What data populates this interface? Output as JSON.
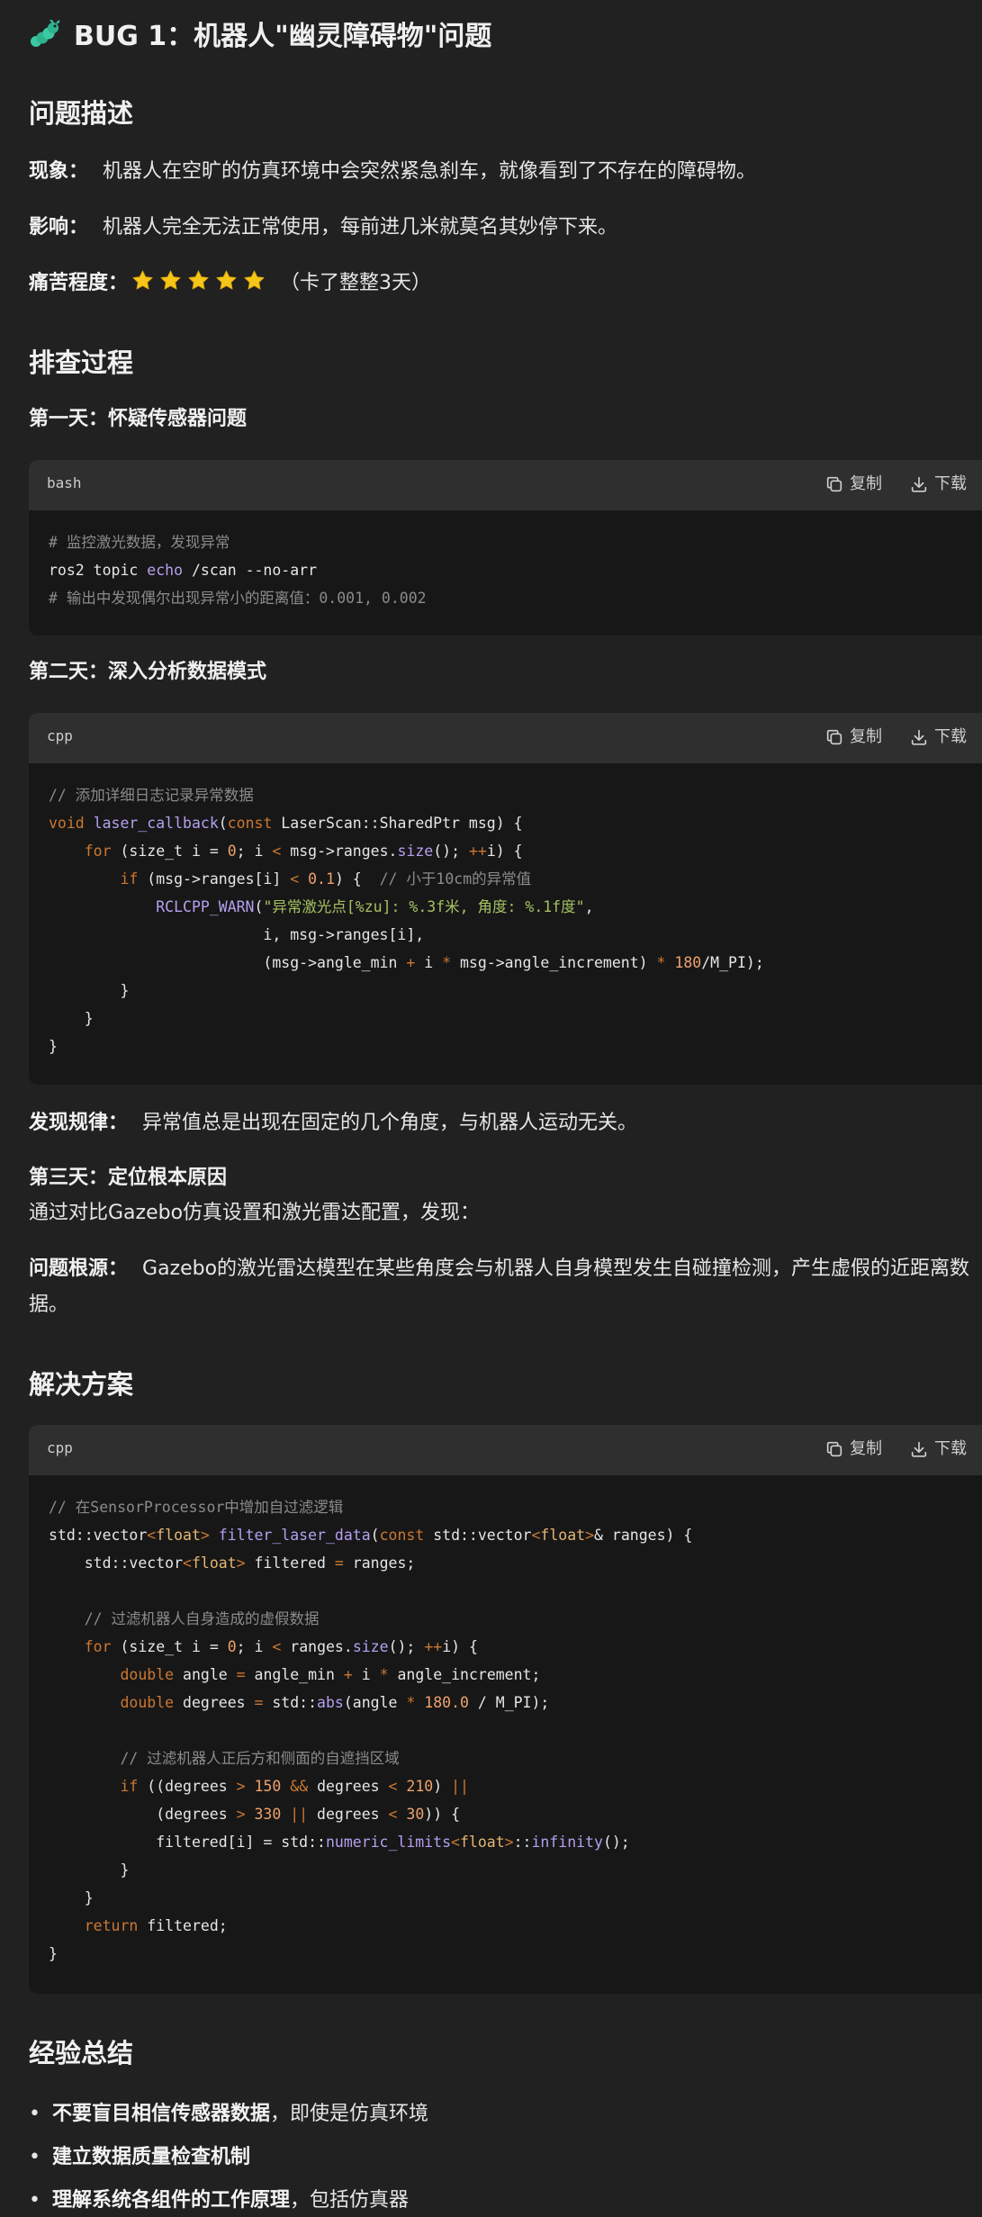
{
  "bug": {
    "icon": "caterpillar-bug-icon",
    "title": "BUG 1：机器人\"幽灵障碍物\"问题"
  },
  "problem": {
    "heading": "问题描述",
    "phenomenon_label": "现象：",
    "phenomenon_text": "机器人在空旷的仿真环境中会突然紧急刹车，就像看到了不存在的障碍物。",
    "impact_label": "影响：",
    "impact_text": "机器人完全无法正常使用，每前进几米就莫名其妙停下来。",
    "pain_label": "痛苦程度：",
    "pain_stars": 5,
    "pain_note": "（卡了整整3天）"
  },
  "investigation": {
    "heading": "排查过程",
    "day1": "第一天：怀疑传感器问题",
    "day2": "第二天：深入分析数据模式",
    "finding_label": "发现规律：",
    "finding_text": "异常值总是出现在固定的几个角度，与机器人运动无关。",
    "day3": "第三天：定位根本原因",
    "day3_text": "通过对比Gazebo仿真设置和激光雷达配置，发现：",
    "root_label": "问题根源：",
    "root_text_line1": "Gazebo的激光雷达模型在某些角度会与机器人自身模型发生自碰撞检测，产生虚假的近距离数",
    "root_text_line2": "据。"
  },
  "solution": {
    "heading": "解决方案"
  },
  "code_ui": {
    "copy_label": "复制",
    "download_label": "下载",
    "copy_icon": "copy-icon",
    "download_icon": "download-icon"
  },
  "code_blocks": [
    {
      "lang": "bash",
      "lines": [
        [
          [
            "c",
            "# 监控激光数据，发现异常"
          ]
        ],
        [
          [
            "p",
            "ros2 topic "
          ],
          [
            "f",
            "echo"
          ],
          [
            "p",
            " /scan --no-arr"
          ]
        ],
        [
          [
            "c",
            "# 输出中发现偶尔出现异常小的距离值：0.001, 0.002"
          ]
        ]
      ]
    },
    {
      "lang": "cpp",
      "lines": [
        [
          [
            "c",
            "// 添加详细日志记录异常数据"
          ]
        ],
        [
          [
            "k",
            "void"
          ],
          [
            "p",
            " "
          ],
          [
            "f",
            "laser_callback"
          ],
          [
            "p",
            "("
          ],
          [
            "k",
            "const"
          ],
          [
            "p",
            " LaserScan::SharedPtr msg) {"
          ]
        ],
        [
          [
            "p",
            "    "
          ],
          [
            "k",
            "for"
          ],
          [
            "p",
            " (size_t i = "
          ],
          [
            "n",
            "0"
          ],
          [
            "p",
            "; i "
          ],
          [
            "k",
            "<"
          ],
          [
            "p",
            " msg->ranges."
          ],
          [
            "f",
            "size"
          ],
          [
            "p",
            "(); "
          ],
          [
            "k",
            "++"
          ],
          [
            "p",
            "i) {"
          ]
        ],
        [
          [
            "p",
            "        "
          ],
          [
            "k",
            "if"
          ],
          [
            "p",
            " (msg->ranges[i] "
          ],
          [
            "k",
            "<"
          ],
          [
            "p",
            " "
          ],
          [
            "n",
            "0.1"
          ],
          [
            "p",
            ") {  "
          ],
          [
            "c",
            "// 小于10cm的异常值"
          ]
        ],
        [
          [
            "p",
            "            "
          ],
          [
            "f",
            "RCLCPP_WARN"
          ],
          [
            "p",
            "("
          ],
          [
            "s",
            "\"异常激光点[%zu]: %.3f米, 角度: %.1f度\""
          ],
          [
            "p",
            ","
          ]
        ],
        [
          [
            "p",
            "                        i, msg->ranges[i],"
          ]
        ],
        [
          [
            "p",
            "                        (msg->angle_min "
          ],
          [
            "k",
            "+"
          ],
          [
            "p",
            " i "
          ],
          [
            "k",
            "*"
          ],
          [
            "p",
            " msg->angle_increment) "
          ],
          [
            "k",
            "*"
          ],
          [
            "p",
            " "
          ],
          [
            "n",
            "180"
          ],
          [
            "p",
            "/M_PI);"
          ]
        ],
        [
          [
            "p",
            "        }"
          ]
        ],
        [
          [
            "p",
            "    }"
          ]
        ],
        [
          [
            "p",
            "}"
          ]
        ]
      ]
    },
    {
      "lang": "cpp",
      "lines": [
        [
          [
            "c",
            "// 在SensorProcessor中增加自过滤逻辑"
          ]
        ],
        [
          [
            "p",
            "std::vector"
          ],
          [
            "k",
            "<"
          ],
          [
            "t",
            "float"
          ],
          [
            "k",
            ">"
          ],
          [
            "p",
            " "
          ],
          [
            "f",
            "filter_laser_data"
          ],
          [
            "p",
            "("
          ],
          [
            "k",
            "const"
          ],
          [
            "p",
            " std::vector"
          ],
          [
            "k",
            "<"
          ],
          [
            "t",
            "float"
          ],
          [
            "k",
            ">"
          ],
          [
            "p",
            "& ranges) {"
          ]
        ],
        [
          [
            "p",
            "    std::vector"
          ],
          [
            "k",
            "<"
          ],
          [
            "t",
            "float"
          ],
          [
            "k",
            ">"
          ],
          [
            "p",
            " filtered "
          ],
          [
            "k",
            "="
          ],
          [
            "p",
            " ranges;"
          ]
        ],
        [
          [
            "p",
            ""
          ]
        ],
        [
          [
            "p",
            "    "
          ],
          [
            "c",
            "// 过滤机器人自身造成的虚假数据"
          ]
        ],
        [
          [
            "p",
            "    "
          ],
          [
            "k",
            "for"
          ],
          [
            "p",
            " (size_t i = "
          ],
          [
            "n",
            "0"
          ],
          [
            "p",
            "; i "
          ],
          [
            "k",
            "<"
          ],
          [
            "p",
            " ranges."
          ],
          [
            "f",
            "size"
          ],
          [
            "p",
            "(); "
          ],
          [
            "k",
            "++"
          ],
          [
            "p",
            "i) {"
          ]
        ],
        [
          [
            "p",
            "        "
          ],
          [
            "k",
            "double"
          ],
          [
            "p",
            " angle "
          ],
          [
            "k",
            "="
          ],
          [
            "p",
            " angle_min "
          ],
          [
            "k",
            "+"
          ],
          [
            "p",
            " i "
          ],
          [
            "k",
            "*"
          ],
          [
            "p",
            " angle_increment;"
          ]
        ],
        [
          [
            "p",
            "        "
          ],
          [
            "k",
            "double"
          ],
          [
            "p",
            " degrees "
          ],
          [
            "k",
            "="
          ],
          [
            "p",
            " std::"
          ],
          [
            "f",
            "abs"
          ],
          [
            "p",
            "(angle "
          ],
          [
            "k",
            "*"
          ],
          [
            "p",
            " "
          ],
          [
            "n",
            "180.0"
          ],
          [
            "p",
            " / M_PI);"
          ]
        ],
        [
          [
            "p",
            ""
          ]
        ],
        [
          [
            "p",
            "        "
          ],
          [
            "c",
            "// 过滤机器人正后方和侧面的自遮挡区域"
          ]
        ],
        [
          [
            "p",
            "        "
          ],
          [
            "k",
            "if"
          ],
          [
            "p",
            " ((degrees "
          ],
          [
            "k",
            ">"
          ],
          [
            "p",
            " "
          ],
          [
            "n",
            "150"
          ],
          [
            "p",
            " "
          ],
          [
            "k",
            "&&"
          ],
          [
            "p",
            " degrees "
          ],
          [
            "k",
            "<"
          ],
          [
            "p",
            " "
          ],
          [
            "n",
            "210"
          ],
          [
            "p",
            ") "
          ],
          [
            "k",
            "||"
          ]
        ],
        [
          [
            "p",
            "            (degrees "
          ],
          [
            "k",
            ">"
          ],
          [
            "p",
            " "
          ],
          [
            "n",
            "330"
          ],
          [
            "p",
            " "
          ],
          [
            "k",
            "||"
          ],
          [
            "p",
            " degrees "
          ],
          [
            "k",
            "<"
          ],
          [
            "p",
            " "
          ],
          [
            "n",
            "30"
          ],
          [
            "p",
            ")) {"
          ]
        ],
        [
          [
            "p",
            "            filtered[i] = std::"
          ],
          [
            "f",
            "numeric_limits"
          ],
          [
            "k",
            "<"
          ],
          [
            "t",
            "float"
          ],
          [
            "k",
            ">"
          ],
          [
            "p",
            "::"
          ],
          [
            "f",
            "infinity"
          ],
          [
            "p",
            "();"
          ]
        ],
        [
          [
            "p",
            "        }"
          ]
        ],
        [
          [
            "p",
            "    }"
          ]
        ],
        [
          [
            "p",
            "    "
          ],
          [
            "k",
            "return"
          ],
          [
            "p",
            " filtered;"
          ]
        ],
        [
          [
            "p",
            "}"
          ]
        ]
      ]
    }
  ],
  "lessons": {
    "heading": "经验总结",
    "items": [
      {
        "bold": "不要盲目相信传感器数据",
        "rest": "，即使是仿真环境"
      },
      {
        "bold": "建立数据质量检查机制",
        "rest": ""
      },
      {
        "bold": "理解系统各组件的工作原理",
        "rest": "，包括仿真器"
      }
    ]
  },
  "colors": {
    "background": "#212121",
    "code_bg": "#171717",
    "code_header": "#2f2f2f",
    "star": "#f5c518",
    "keyword": "#cc7832",
    "function": "#b4a0f0",
    "string": "#a5c261",
    "number": "#f0a26c",
    "comment": "#8b8b8b",
    "bug_icon": "#3ac9a2"
  }
}
